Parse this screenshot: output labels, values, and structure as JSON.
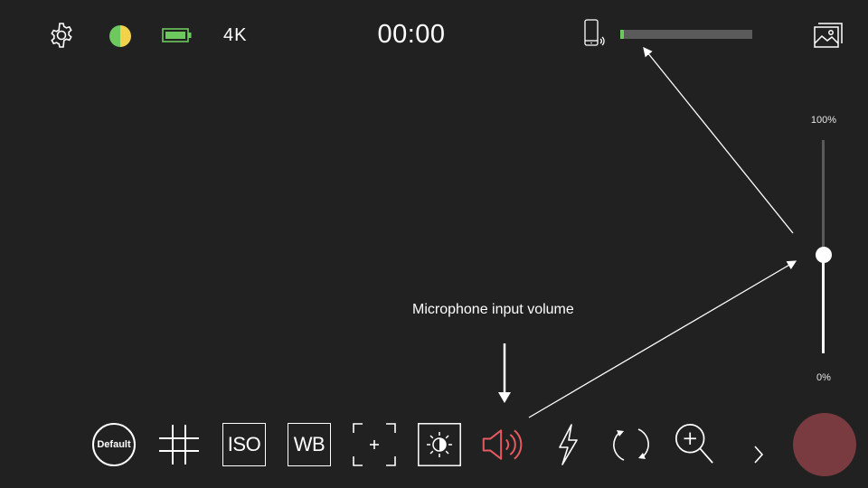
{
  "top_bar": {
    "settings_icon": "gear-icon",
    "color_mode_icon": "half-circle-icon",
    "battery_icon": "battery-icon",
    "resolution": "4K",
    "timer": "00:00",
    "device_audio_icon": "phone-audio-icon",
    "audio_level": 0.03,
    "gallery_icon": "gallery-icon"
  },
  "colors": {
    "background": "#212121",
    "meter_active": "#6dc95d",
    "meter_track": "#5a5a5a",
    "mic_icon": "#e35b5f",
    "record_button": "#7a3b40",
    "color_mode_left": "#6dc95d",
    "color_mode_right": "#f2d24a"
  },
  "volume_slider": {
    "max_label": "100%",
    "min_label": "0%",
    "value": 0.46
  },
  "annotation": {
    "text": "Microphone input volume"
  },
  "toolbar": {
    "default_label": "Default",
    "grid_icon": "grid-icon",
    "iso_label": "ISO",
    "wb_label": "WB",
    "focus_icon": "focus-frame-icon",
    "exposure_icon": "exposure-icon",
    "mic_icon": "speaker-volume-icon",
    "flash_icon": "flash-icon",
    "switch_camera_icon": "switch-camera-icon",
    "zoom_icon": "zoom-in-icon",
    "more_icon": "chevron-right-icon",
    "record_icon": "record-button"
  }
}
